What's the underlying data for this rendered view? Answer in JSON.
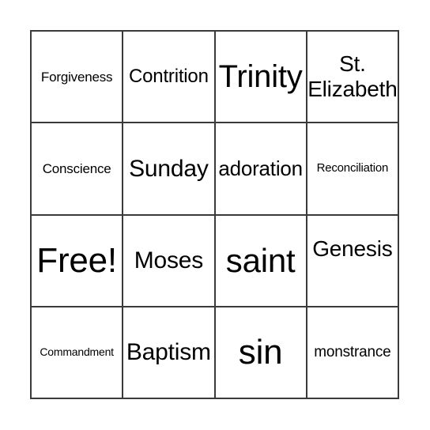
{
  "card": {
    "type": "bingo-card",
    "rows": 4,
    "columns": 4,
    "border_color": "#3a3a3a",
    "background_color": "#ffffff",
    "text_color": "#000000",
    "free_space_label": "Free!",
    "cells": [
      {
        "text": "Forgiveness",
        "size": "fs-s",
        "row": 1,
        "col": 1
      },
      {
        "text": "Contrition",
        "size": "fs-m",
        "row": 1,
        "col": 2
      },
      {
        "text": "Trinity",
        "size": "fs-xxl",
        "row": 1,
        "col": 3
      },
      {
        "text": "St.\nElizabeth",
        "size": "fs-l",
        "row": 1,
        "col": 4
      },
      {
        "text": "Conscience",
        "size": "fs-s",
        "row": 2,
        "col": 1
      },
      {
        "text": "Sunday",
        "size": "fs-xl",
        "row": 2,
        "col": 2
      },
      {
        "text": "adoration",
        "size": "fs-ml",
        "row": 2,
        "col": 3
      },
      {
        "text": "Reconciliation",
        "size": "fs-xs",
        "row": 2,
        "col": 4
      },
      {
        "text": "Free!",
        "size": "fs-4xl",
        "row": 3,
        "col": 1
      },
      {
        "text": "Moses",
        "size": "fs-xl",
        "row": 3,
        "col": 2
      },
      {
        "text": "saint",
        "size": "fs-3xl",
        "row": 3,
        "col": 3
      },
      {
        "text": "Genesis",
        "size": "fs-l",
        "row": 3,
        "col": 4
      },
      {
        "text": "Commandment",
        "size": "fs-xxs",
        "row": 4,
        "col": 1
      },
      {
        "text": "Baptism",
        "size": "fs-xl",
        "row": 4,
        "col": 2
      },
      {
        "text": "sin",
        "size": "fs-4xl",
        "row": 4,
        "col": 3
      },
      {
        "text": "monstrance",
        "size": "fs-sm",
        "row": 4,
        "col": 4
      }
    ]
  }
}
